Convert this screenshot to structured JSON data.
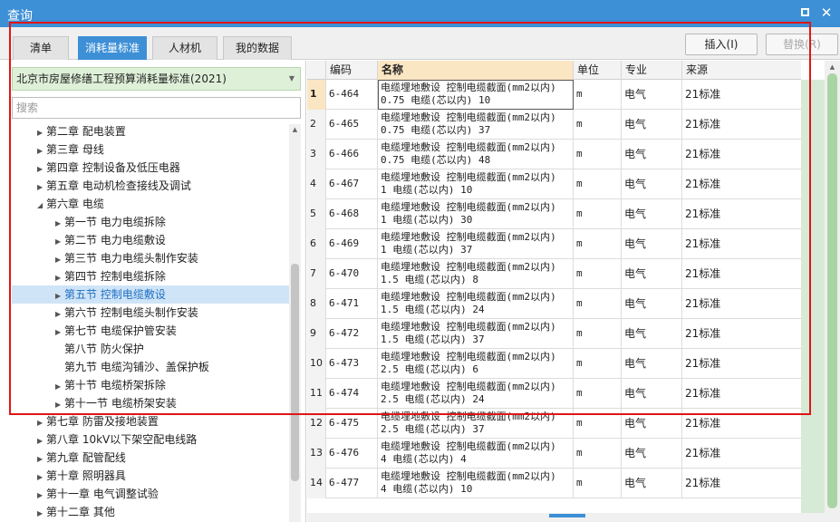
{
  "window": {
    "title": "查询"
  },
  "tabs": [
    {
      "label": "清单",
      "active": false
    },
    {
      "label": "消耗量标准",
      "active": true
    },
    {
      "label": "人材机",
      "active": false
    },
    {
      "label": "我的数据",
      "active": false
    }
  ],
  "actions": {
    "insert_label": "插入(I)",
    "replace_label": "替换(R)"
  },
  "standard_selector": {
    "value": "北京市房屋修缮工程预算消耗量标准(2021)"
  },
  "search": {
    "placeholder": "搜索"
  },
  "tree": [
    {
      "label": "第二章 配电装置",
      "expand": "right"
    },
    {
      "label": "第三章 母线",
      "expand": "right"
    },
    {
      "label": "第四章 控制设备及低压电器",
      "expand": "right"
    },
    {
      "label": "第五章 电动机检查接线及调试",
      "expand": "right"
    },
    {
      "label": "第六章 电缆",
      "expand": "down"
    },
    {
      "label": "第一节 电力电缆拆除",
      "expand": "right",
      "indent": 1
    },
    {
      "label": "第二节 电力电缆敷设",
      "expand": "right",
      "indent": 1
    },
    {
      "label": "第三节 电力电缆头制作安装",
      "expand": "right",
      "indent": 1
    },
    {
      "label": "第四节 控制电缆拆除",
      "expand": "right",
      "indent": 1
    },
    {
      "label": "第五节 控制电缆敷设",
      "expand": "right",
      "indent": 1,
      "selected": true
    },
    {
      "label": "第六节 控制电缆头制作安装",
      "expand": "right",
      "indent": 1
    },
    {
      "label": "第七节 电缆保护管安装",
      "expand": "right",
      "indent": 1
    },
    {
      "label": "第八节 防火保护",
      "expand": "none",
      "indent": 1
    },
    {
      "label": "第九节 电缆沟铺沙、盖保护板",
      "expand": "none",
      "indent": 1
    },
    {
      "label": "第十节 电缆桥架拆除",
      "expand": "right",
      "indent": 1
    },
    {
      "label": "第十一节 电缆桥架安装",
      "expand": "right",
      "indent": 1
    },
    {
      "label": "第七章 防雷及接地装置",
      "expand": "right"
    },
    {
      "label": "第八章 10kV以下架空配电线路",
      "expand": "right"
    },
    {
      "label": "第九章 配管配线",
      "expand": "right"
    },
    {
      "label": "第十章 照明器具",
      "expand": "right"
    },
    {
      "label": "第十一章 电气调整试验",
      "expand": "right"
    },
    {
      "label": "第十二章 其他",
      "expand": "right"
    }
  ],
  "grid": {
    "columns": [
      "编码",
      "名称",
      "单位",
      "专业",
      "来源"
    ],
    "rows": [
      {
        "rn": "1",
        "code": "6-464",
        "name1": "电缆埋地敷设 控制电缆截面(mm2以内)",
        "name2": "0.75 电缆(芯以内) 10",
        "unit": "m",
        "spec": "电气",
        "source": "21标准"
      },
      {
        "rn": "2",
        "code": "6-465",
        "name1": "电缆埋地敷设 控制电缆截面(mm2以内)",
        "name2": "0.75 电缆(芯以内) 37",
        "unit": "m",
        "spec": "电气",
        "source": "21标准"
      },
      {
        "rn": "3",
        "code": "6-466",
        "name1": "电缆埋地敷设 控制电缆截面(mm2以内)",
        "name2": "0.75 电缆(芯以内) 48",
        "unit": "m",
        "spec": "电气",
        "source": "21标准"
      },
      {
        "rn": "4",
        "code": "6-467",
        "name1": "电缆埋地敷设 控制电缆截面(mm2以内)",
        "name2": "1 电缆(芯以内) 10",
        "unit": "m",
        "spec": "电气",
        "source": "21标准"
      },
      {
        "rn": "5",
        "code": "6-468",
        "name1": "电缆埋地敷设 控制电缆截面(mm2以内)",
        "name2": "1 电缆(芯以内) 30",
        "unit": "m",
        "spec": "电气",
        "source": "21标准"
      },
      {
        "rn": "6",
        "code": "6-469",
        "name1": "电缆埋地敷设 控制电缆截面(mm2以内)",
        "name2": "1 电缆(芯以内) 37",
        "unit": "m",
        "spec": "电气",
        "source": "21标准"
      },
      {
        "rn": "7",
        "code": "6-470",
        "name1": "电缆埋地敷设 控制电缆截面(mm2以内)",
        "name2": "1.5 电缆(芯以内) 8",
        "unit": "m",
        "spec": "电气",
        "source": "21标准"
      },
      {
        "rn": "8",
        "code": "6-471",
        "name1": "电缆埋地敷设 控制电缆截面(mm2以内)",
        "name2": "1.5 电缆(芯以内) 24",
        "unit": "m",
        "spec": "电气",
        "source": "21标准"
      },
      {
        "rn": "9",
        "code": "6-472",
        "name1": "电缆埋地敷设 控制电缆截面(mm2以内)",
        "name2": "1.5 电缆(芯以内) 37",
        "unit": "m",
        "spec": "电气",
        "source": "21标准"
      },
      {
        "rn": "10",
        "code": "6-473",
        "name1": "电缆埋地敷设 控制电缆截面(mm2以内)",
        "name2": "2.5 电缆(芯以内) 6",
        "unit": "m",
        "spec": "电气",
        "source": "21标准"
      },
      {
        "rn": "11",
        "code": "6-474",
        "name1": "电缆埋地敷设 控制电缆截面(mm2以内)",
        "name2": "2.5 电缆(芯以内) 24",
        "unit": "m",
        "spec": "电气",
        "source": "21标准"
      },
      {
        "rn": "12",
        "code": "6-475",
        "name1": "电缆埋地敷设 控制电缆截面(mm2以内)",
        "name2": "2.5 电缆(芯以内) 37",
        "unit": "m",
        "spec": "电气",
        "source": "21标准"
      },
      {
        "rn": "13",
        "code": "6-476",
        "name1": "电缆埋地敷设 控制电缆截面(mm2以内)",
        "name2": "4 电缆(芯以内) 4",
        "unit": "m",
        "spec": "电气",
        "source": "21标准"
      },
      {
        "rn": "14",
        "code": "6-477",
        "name1": "电缆埋地敷设 控制电缆截面(mm2以内)",
        "name2": "4 电缆(芯以内) 10",
        "unit": "m",
        "spec": "电气",
        "source": "21标准"
      }
    ]
  },
  "colors": {
    "accent": "#3d8fd6",
    "selected_row": "#fbe6c3",
    "highlight_box": "#e01515",
    "selector_bg": "#dff0d9"
  }
}
